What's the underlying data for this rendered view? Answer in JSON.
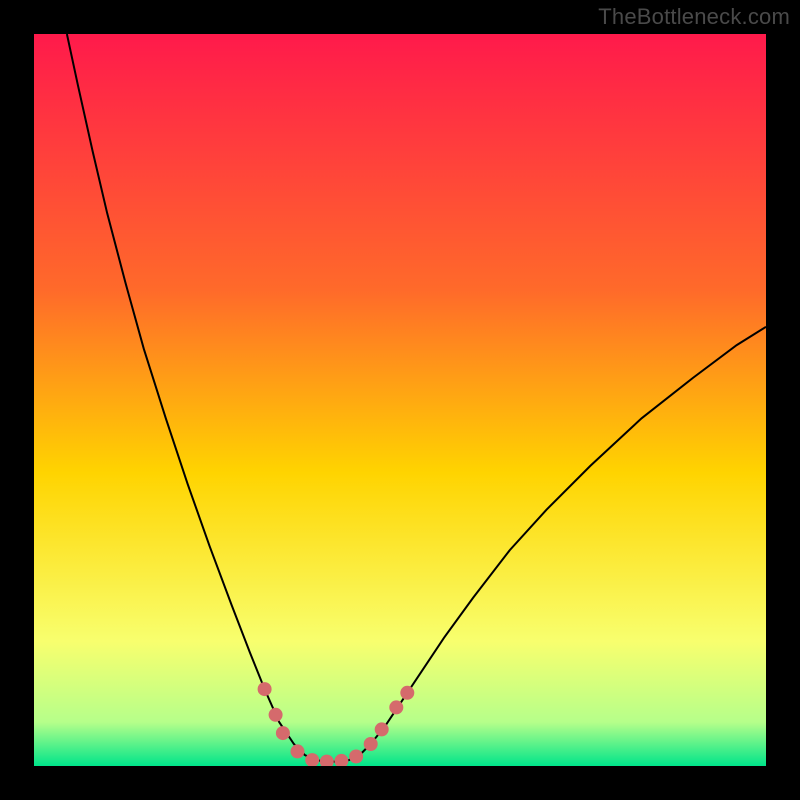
{
  "attribution": "TheBottleneck.com",
  "colors": {
    "background": "#000000",
    "attribution_text": "#4a4a4a",
    "curve": "#000000",
    "marker": "#d56a6c",
    "gradient_top": "#ff1a4b",
    "gradient_mid_upper": "#ff6a2a",
    "gradient_mid": "#ffd400",
    "gradient_lower": "#f8ff6e",
    "gradient_near_bottom": "#b6ff8a",
    "gradient_bottom": "#00e58a"
  },
  "chart_data": {
    "type": "line",
    "title": "",
    "xlabel": "",
    "ylabel": "",
    "xlim": [
      0,
      100
    ],
    "ylim": [
      0,
      100
    ],
    "grid": false,
    "curve": [
      {
        "x": 4.5,
        "y": 100.0
      },
      {
        "x": 6.0,
        "y": 93.0
      },
      {
        "x": 8.0,
        "y": 84.0
      },
      {
        "x": 10.0,
        "y": 75.5
      },
      {
        "x": 12.5,
        "y": 66.0
      },
      {
        "x": 15.0,
        "y": 57.0
      },
      {
        "x": 18.0,
        "y": 47.5
      },
      {
        "x": 21.0,
        "y": 38.5
      },
      {
        "x": 24.0,
        "y": 30.0
      },
      {
        "x": 27.0,
        "y": 22.0
      },
      {
        "x": 29.5,
        "y": 15.5
      },
      {
        "x": 31.5,
        "y": 10.5
      },
      {
        "x": 33.5,
        "y": 6.0
      },
      {
        "x": 35.5,
        "y": 3.0
      },
      {
        "x": 37.0,
        "y": 1.5
      },
      {
        "x": 38.5,
        "y": 0.8
      },
      {
        "x": 40.0,
        "y": 0.6
      },
      {
        "x": 41.5,
        "y": 0.6
      },
      {
        "x": 43.0,
        "y": 0.8
      },
      {
        "x": 44.5,
        "y": 1.5
      },
      {
        "x": 46.0,
        "y": 3.0
      },
      {
        "x": 48.0,
        "y": 5.5
      },
      {
        "x": 50.0,
        "y": 8.5
      },
      {
        "x": 53.0,
        "y": 13.0
      },
      {
        "x": 56.0,
        "y": 17.5
      },
      {
        "x": 60.0,
        "y": 23.0
      },
      {
        "x": 65.0,
        "y": 29.5
      },
      {
        "x": 70.0,
        "y": 35.0
      },
      {
        "x": 76.0,
        "y": 41.0
      },
      {
        "x": 83.0,
        "y": 47.5
      },
      {
        "x": 90.0,
        "y": 53.0
      },
      {
        "x": 96.0,
        "y": 57.5
      },
      {
        "x": 100.0,
        "y": 60.0
      }
    ],
    "markers": [
      {
        "x": 31.5,
        "y": 10.5
      },
      {
        "x": 33.0,
        "y": 7.0
      },
      {
        "x": 34.0,
        "y": 4.5
      },
      {
        "x": 36.0,
        "y": 2.0
      },
      {
        "x": 38.0,
        "y": 0.8
      },
      {
        "x": 40.0,
        "y": 0.6
      },
      {
        "x": 42.0,
        "y": 0.7
      },
      {
        "x": 44.0,
        "y": 1.3
      },
      {
        "x": 46.0,
        "y": 3.0
      },
      {
        "x": 47.5,
        "y": 5.0
      },
      {
        "x": 49.5,
        "y": 8.0
      },
      {
        "x": 51.0,
        "y": 10.0
      }
    ]
  }
}
